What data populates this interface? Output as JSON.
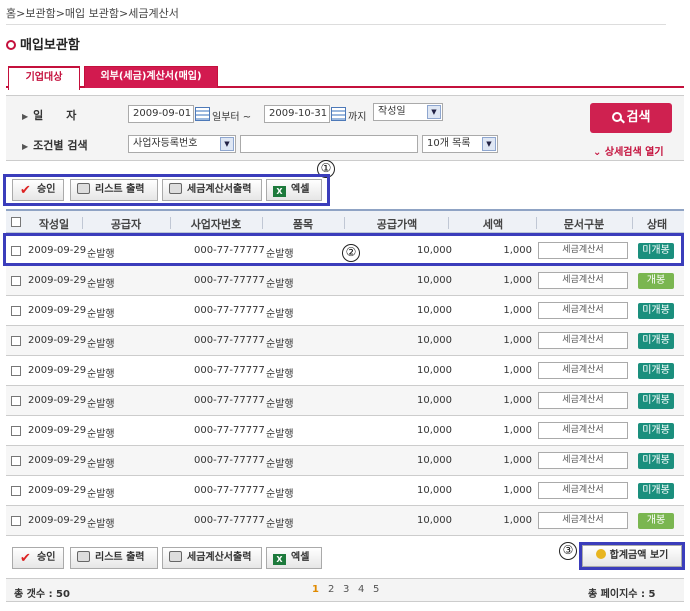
{
  "breadcrumb": "홈>보관함>매입 보관함>세금계산서",
  "page_title": "매입보관함",
  "tabs": [
    {
      "label": "기업대상",
      "active": true
    },
    {
      "label": "외부(세금)계산서(매입)",
      "active": false
    }
  ],
  "search": {
    "date_label": "일      자",
    "date_from": "2009-09-01",
    "from_suffix": "일부터 ~",
    "date_to": "2009-10-31",
    "to_suffix": "까지",
    "date_type": "작성일",
    "cond_label": "조건별 검색",
    "cond_field": "사업자등록번호",
    "cond_value": "",
    "page_size": "10개 목록",
    "search_button": "검색",
    "advanced_link": "상세검색 열기"
  },
  "toolbar": {
    "approve": "승인",
    "list_print": "리스트 출력",
    "invoice_print": "세금계산서출력",
    "excel": "엑셀"
  },
  "annotations": [
    "①",
    "②",
    "③"
  ],
  "table": {
    "headers": [
      "작성일",
      "공급자",
      "사업자번호",
      "품목",
      "공급가액",
      "세액",
      "문서구분",
      "상태"
    ],
    "rows": [
      {
        "date": "2009-09-29",
        "supplier": "순발행",
        "bizno": "000-77-77777",
        "item": "순발행",
        "amount": "10,000",
        "tax": "1,000",
        "doc": "세금계산서",
        "status": "미개봉"
      },
      {
        "date": "2009-09-29",
        "supplier": "순발행",
        "bizno": "000-77-77777",
        "item": "순발행",
        "amount": "10,000",
        "tax": "1,000",
        "doc": "세금계산서",
        "status": "개봉"
      },
      {
        "date": "2009-09-29",
        "supplier": "순발행",
        "bizno": "000-77-77777",
        "item": "순발행",
        "amount": "10,000",
        "tax": "1,000",
        "doc": "세금계산서",
        "status": "미개봉"
      },
      {
        "date": "2009-09-29",
        "supplier": "순발행",
        "bizno": "000-77-77777",
        "item": "순발행",
        "amount": "10,000",
        "tax": "1,000",
        "doc": "세금계산서",
        "status": "미개봉"
      },
      {
        "date": "2009-09-29",
        "supplier": "순발행",
        "bizno": "000-77-77777",
        "item": "순발행",
        "amount": "10,000",
        "tax": "1,000",
        "doc": "세금계산서",
        "status": "미개봉"
      },
      {
        "date": "2009-09-29",
        "supplier": "순발행",
        "bizno": "000-77-77777",
        "item": "순발행",
        "amount": "10,000",
        "tax": "1,000",
        "doc": "세금계산서",
        "status": "미개봉"
      },
      {
        "date": "2009-09-29",
        "supplier": "순발행",
        "bizno": "000-77-77777",
        "item": "순발행",
        "amount": "10,000",
        "tax": "1,000",
        "doc": "세금계산서",
        "status": "미개봉"
      },
      {
        "date": "2009-09-29",
        "supplier": "순발행",
        "bizno": "000-77-77777",
        "item": "순발행",
        "amount": "10,000",
        "tax": "1,000",
        "doc": "세금계산서",
        "status": "미개봉"
      },
      {
        "date": "2009-09-29",
        "supplier": "순발행",
        "bizno": "000-77-77777",
        "item": "순발행",
        "amount": "10,000",
        "tax": "1,000",
        "doc": "세금계산서",
        "status": "미개봉"
      },
      {
        "date": "2009-09-29",
        "supplier": "순발행",
        "bizno": "000-77-77777",
        "item": "순발행",
        "amount": "10,000",
        "tax": "1,000",
        "doc": "세금계산서",
        "status": "개봉"
      }
    ]
  },
  "sum_button": "합계금액 보기",
  "footer": {
    "total_label": "총 갯수 : 50",
    "pages": [
      "1",
      "2",
      "3",
      "4",
      "5"
    ],
    "current_page": "1",
    "total_pages_label": "총 페이지수 : 5"
  },
  "colors": {
    "accent": "#c4103c",
    "unopened": "#1b8f7d",
    "opened": "#7ab650",
    "annotation": "#3b3dbb"
  }
}
